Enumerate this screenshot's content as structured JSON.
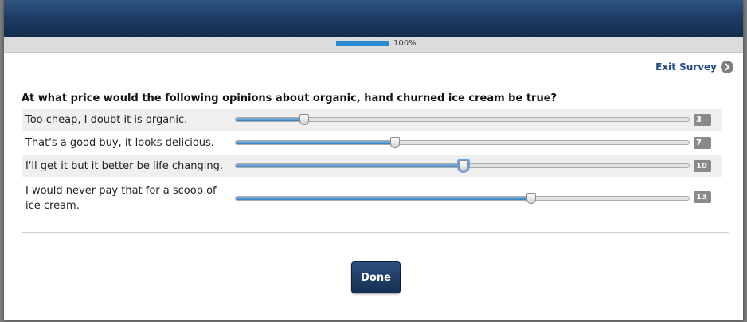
{
  "progress": {
    "label": "100%",
    "fraction": 1.0
  },
  "exit_survey": {
    "label": "Exit Survey",
    "icon": "chevron-right-icon"
  },
  "question": "At what price would the following opinions about organic, hand churned ice cream be true?",
  "slider_scale": {
    "min": 0,
    "max": 20
  },
  "rows": [
    {
      "label": "Too cheap, I doubt it is organic.",
      "value": 3,
      "display": "3"
    },
    {
      "label": "That's a good buy, it looks delicious.",
      "value": 7,
      "display": "7"
    },
    {
      "label": "I'll get it but it better be life changing.",
      "value": 10,
      "display": "10"
    },
    {
      "label": "I would never pay that for a scoop of ice cream.",
      "value": 13,
      "display": "13"
    }
  ],
  "done_button": {
    "label": "Done"
  },
  "colors": {
    "header": "#1f3e66",
    "progress_fill": "#2a8ccf",
    "link": "#1f4c86"
  }
}
